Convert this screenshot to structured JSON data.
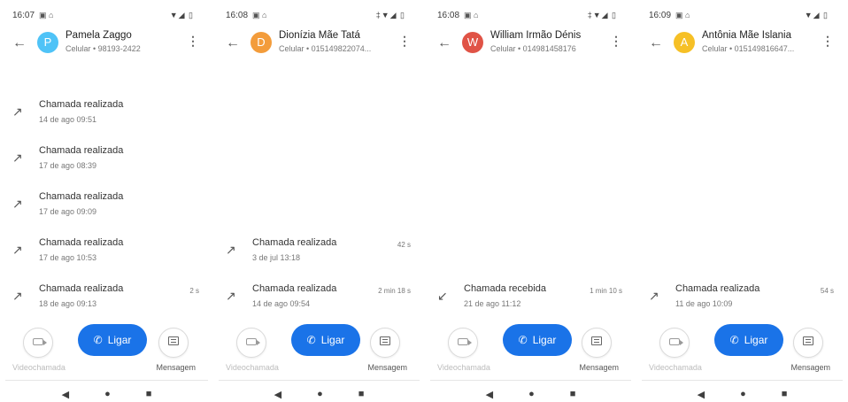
{
  "screens": [
    {
      "status": {
        "time": "16:07",
        "icons": "▼◢ ▯"
      },
      "contact": {
        "name": "Pamela Zaggo",
        "subtitle": "Celular • 98193-2422",
        "avatar_letter": "P",
        "avatar_color": "#4fc3f7"
      },
      "calls": [
        {
          "title": "Chamada realizada",
          "time": "14 de ago 09:51",
          "duration": "",
          "direction": "outgoing"
        },
        {
          "title": "Chamada realizada",
          "time": "17 de ago 08:39",
          "duration": "",
          "direction": "outgoing"
        },
        {
          "title": "Chamada realizada",
          "time": "17 de ago 09:09",
          "duration": "",
          "direction": "outgoing"
        },
        {
          "title": "Chamada realizada",
          "time": "17 de ago 10:53",
          "duration": "",
          "direction": "outgoing"
        },
        {
          "title": "Chamada realizada",
          "time": "18 de ago 09:13",
          "duration": "2 s",
          "direction": "outgoing"
        }
      ],
      "labels": {
        "call": "Ligar",
        "video": "Videochamada",
        "message": "Mensagem"
      }
    },
    {
      "status": {
        "time": "16:08",
        "icons": "‡▼◢ ▯"
      },
      "contact": {
        "name": "Dionízia Mãe Tatá",
        "subtitle": "Celular • 015149822074...",
        "avatar_letter": "D",
        "avatar_color": "#f39c3b"
      },
      "calls": [
        {
          "title": "Chamada realizada",
          "time": "3 de jul 13:18",
          "duration": "42 s",
          "direction": "outgoing"
        },
        {
          "title": "Chamada realizada",
          "time": "14 de ago 09:54",
          "duration": "2 min 18 s",
          "direction": "outgoing"
        }
      ],
      "labels": {
        "call": "Ligar",
        "video": "Videochamada",
        "message": "Mensagem"
      }
    },
    {
      "status": {
        "time": "16:08",
        "icons": "‡▼◢ ▯"
      },
      "contact": {
        "name": "William Irmão Dénis",
        "subtitle": "Celular • 014981458176",
        "avatar_letter": "W",
        "avatar_color": "#e05346"
      },
      "calls": [
        {
          "title": "Chamada recebida",
          "time": "21 de ago 11:12",
          "duration": "1 min 10 s",
          "direction": "incoming"
        }
      ],
      "labels": {
        "call": "Ligar",
        "video": "Videochamada",
        "message": "Mensagem"
      }
    },
    {
      "status": {
        "time": "16:09",
        "icons": "▼◢ ▯"
      },
      "contact": {
        "name": "Antônia Mãe Islania",
        "subtitle": "Celular • 015149816647...",
        "avatar_letter": "A",
        "avatar_color": "#f6c026"
      },
      "calls": [
        {
          "title": "Chamada realizada",
          "time": "11 de ago 10:09",
          "duration": "54 s",
          "direction": "outgoing"
        }
      ],
      "labels": {
        "call": "Ligar",
        "video": "Videochamada",
        "message": "Mensagem"
      }
    }
  ]
}
